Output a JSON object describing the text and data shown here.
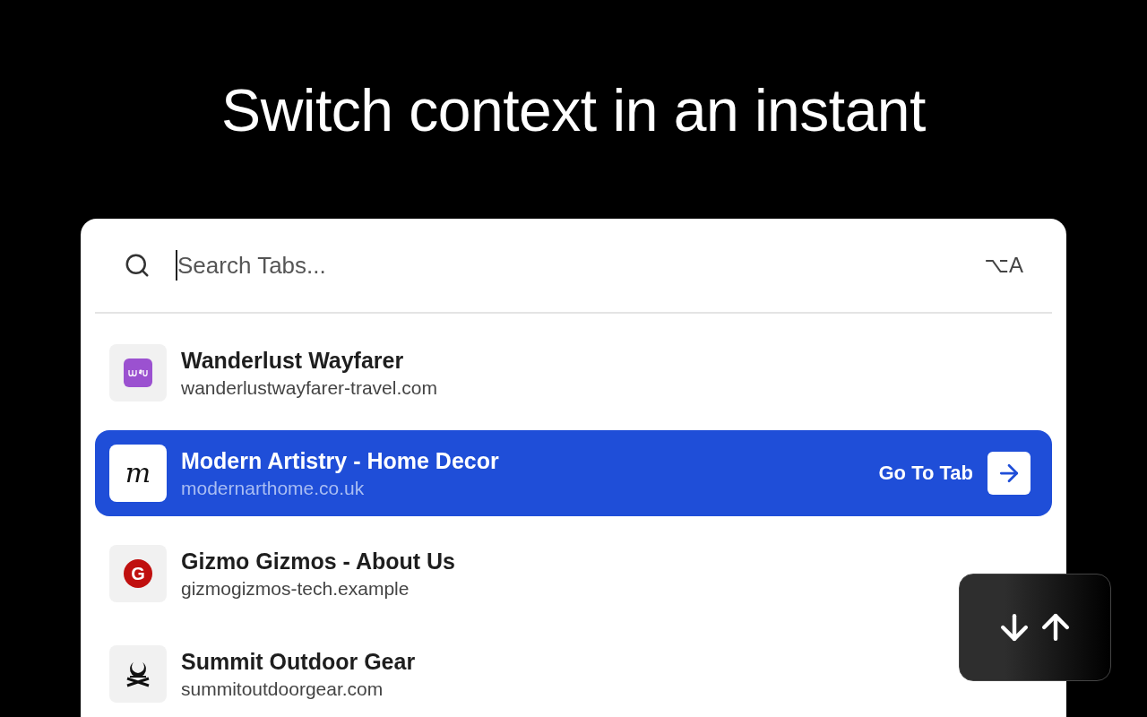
{
  "headline": "Switch context in an instant",
  "search": {
    "placeholder": "Search Tabs...",
    "shortcut": "⌥A"
  },
  "tabs": [
    {
      "title": "Wanderlust Wayfarer",
      "url": "wanderlustwayfarer-travel.com",
      "selected": false,
      "favicon": {
        "kind": "squiggle",
        "color": "#9b51d0"
      }
    },
    {
      "title": "Modern Artistry - Home Decor",
      "url": "modernarthome.co.uk",
      "selected": true,
      "favicon": {
        "kind": "letter",
        "glyph": "m"
      },
      "action": "Go To Tab"
    },
    {
      "title": "Gizmo Gizmos - About Us",
      "url": "gizmogizmos-tech.example",
      "selected": false,
      "favicon": {
        "kind": "badge",
        "glyph": "G",
        "color": "#c0100f"
      }
    },
    {
      "title": "Summit Outdoor Gear",
      "url": "summitoutdoorgear.com",
      "selected": false,
      "favicon": {
        "kind": "campfire"
      }
    }
  ]
}
